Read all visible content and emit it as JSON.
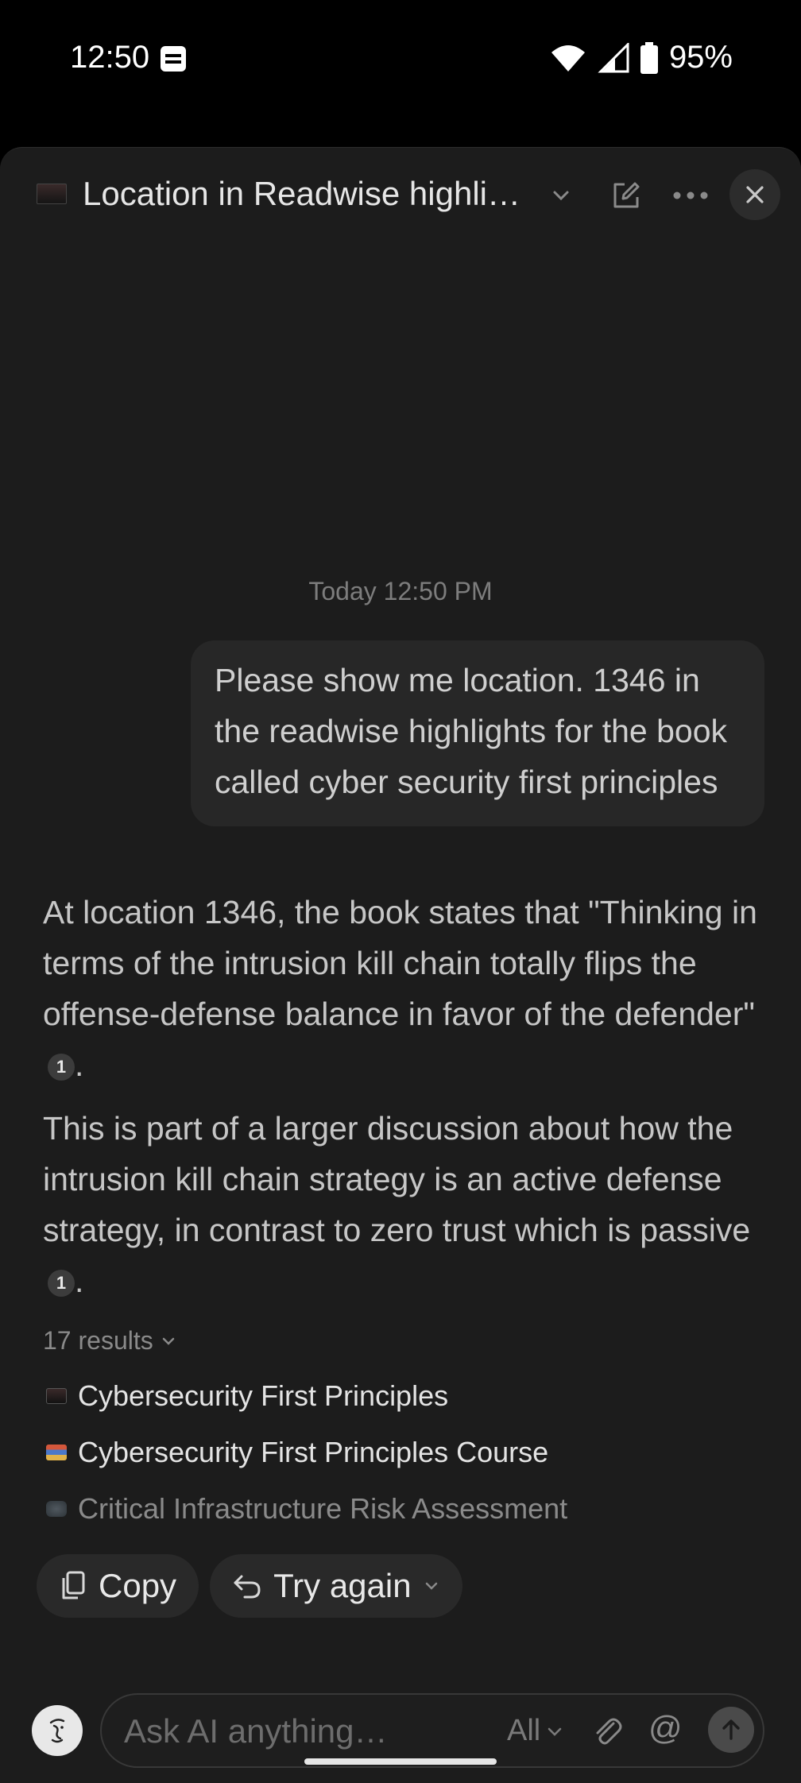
{
  "status_bar": {
    "time": "12:50",
    "battery": "95%"
  },
  "header": {
    "title": "Location in Readwise highli…"
  },
  "conversation": {
    "timestamp": "Today 12:50 PM",
    "user_message": "Please show me location. 1346 in the readwise highlights for the book called cyber security first principles",
    "answer_paragraphs": [
      "At location 1346, the book states that \"Thinking in terms of the intrusion kill chain totally flips the offense-defense balance in favor of the defender\"",
      "This is part of a larger discussion about how the intrusion kill chain strategy is an active defense strategy, in contrast to zero trust which is passive"
    ],
    "citation_number": "1",
    "period": "."
  },
  "results": {
    "toggle_label": "17 results",
    "items": [
      {
        "title": "Cybersecurity First Principles",
        "icon": "book-cover-icon"
      },
      {
        "title": "Cybersecurity First Principles Course",
        "icon": "books-icon"
      },
      {
        "title": "Critical Infrastructure Risk Assessment",
        "icon": "book-cover-icon"
      }
    ]
  },
  "actions": {
    "copy_label": "Copy",
    "try_again_label": "Try again"
  },
  "composer": {
    "placeholder": "Ask AI anything…",
    "scope": "All",
    "mention_symbol": "@"
  }
}
